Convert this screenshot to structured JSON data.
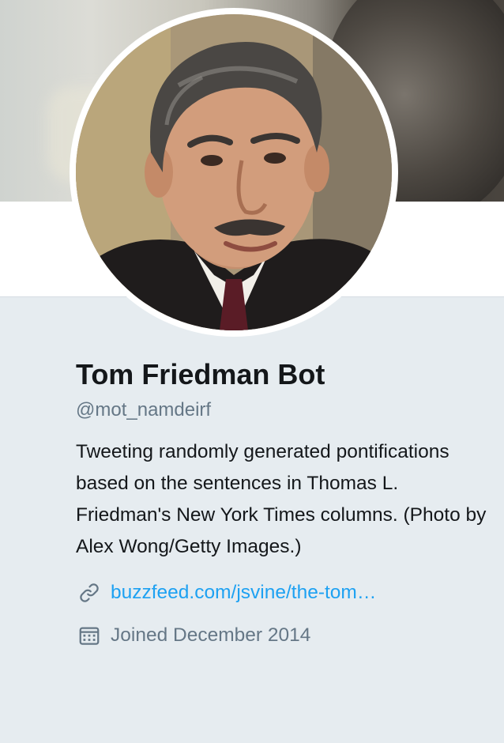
{
  "profile": {
    "display_name": "Tom Friedman Bot",
    "handle": "@mot_namdeirf",
    "bio": "Tweeting randomly generated pontifications based on the sentences in Thomas L. Friedman's New York Times columns. (Photo by Alex Wong/Getty Images.)",
    "website_display": "buzzfeed.com/jsvine/the-tom…",
    "joined": "Joined December 2014"
  },
  "icons": {
    "link": "link-icon",
    "calendar": "calendar-icon"
  },
  "colors": {
    "link": "#1da1f2",
    "secondary_text": "#657786",
    "primary_text": "#14171a",
    "page_background": "#e6ecf0"
  }
}
